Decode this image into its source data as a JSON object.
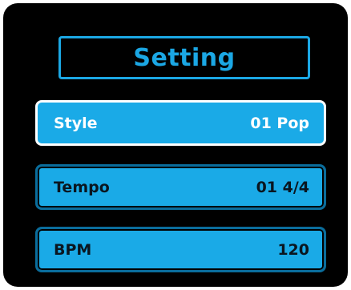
{
  "header": {
    "title": "Setting"
  },
  "menu": {
    "items": [
      {
        "label": "Style",
        "value": "01 Pop",
        "selected": true
      },
      {
        "label": "Tempo",
        "value": "01 4/4",
        "selected": false
      },
      {
        "label": "BPM",
        "value": "120",
        "selected": false
      }
    ]
  },
  "colors": {
    "background": "#000000",
    "accent": "#1ba7e4",
    "item_fill": "#1aaae7",
    "item_border": "#0a6d9c",
    "selected_border": "#ffffff"
  }
}
